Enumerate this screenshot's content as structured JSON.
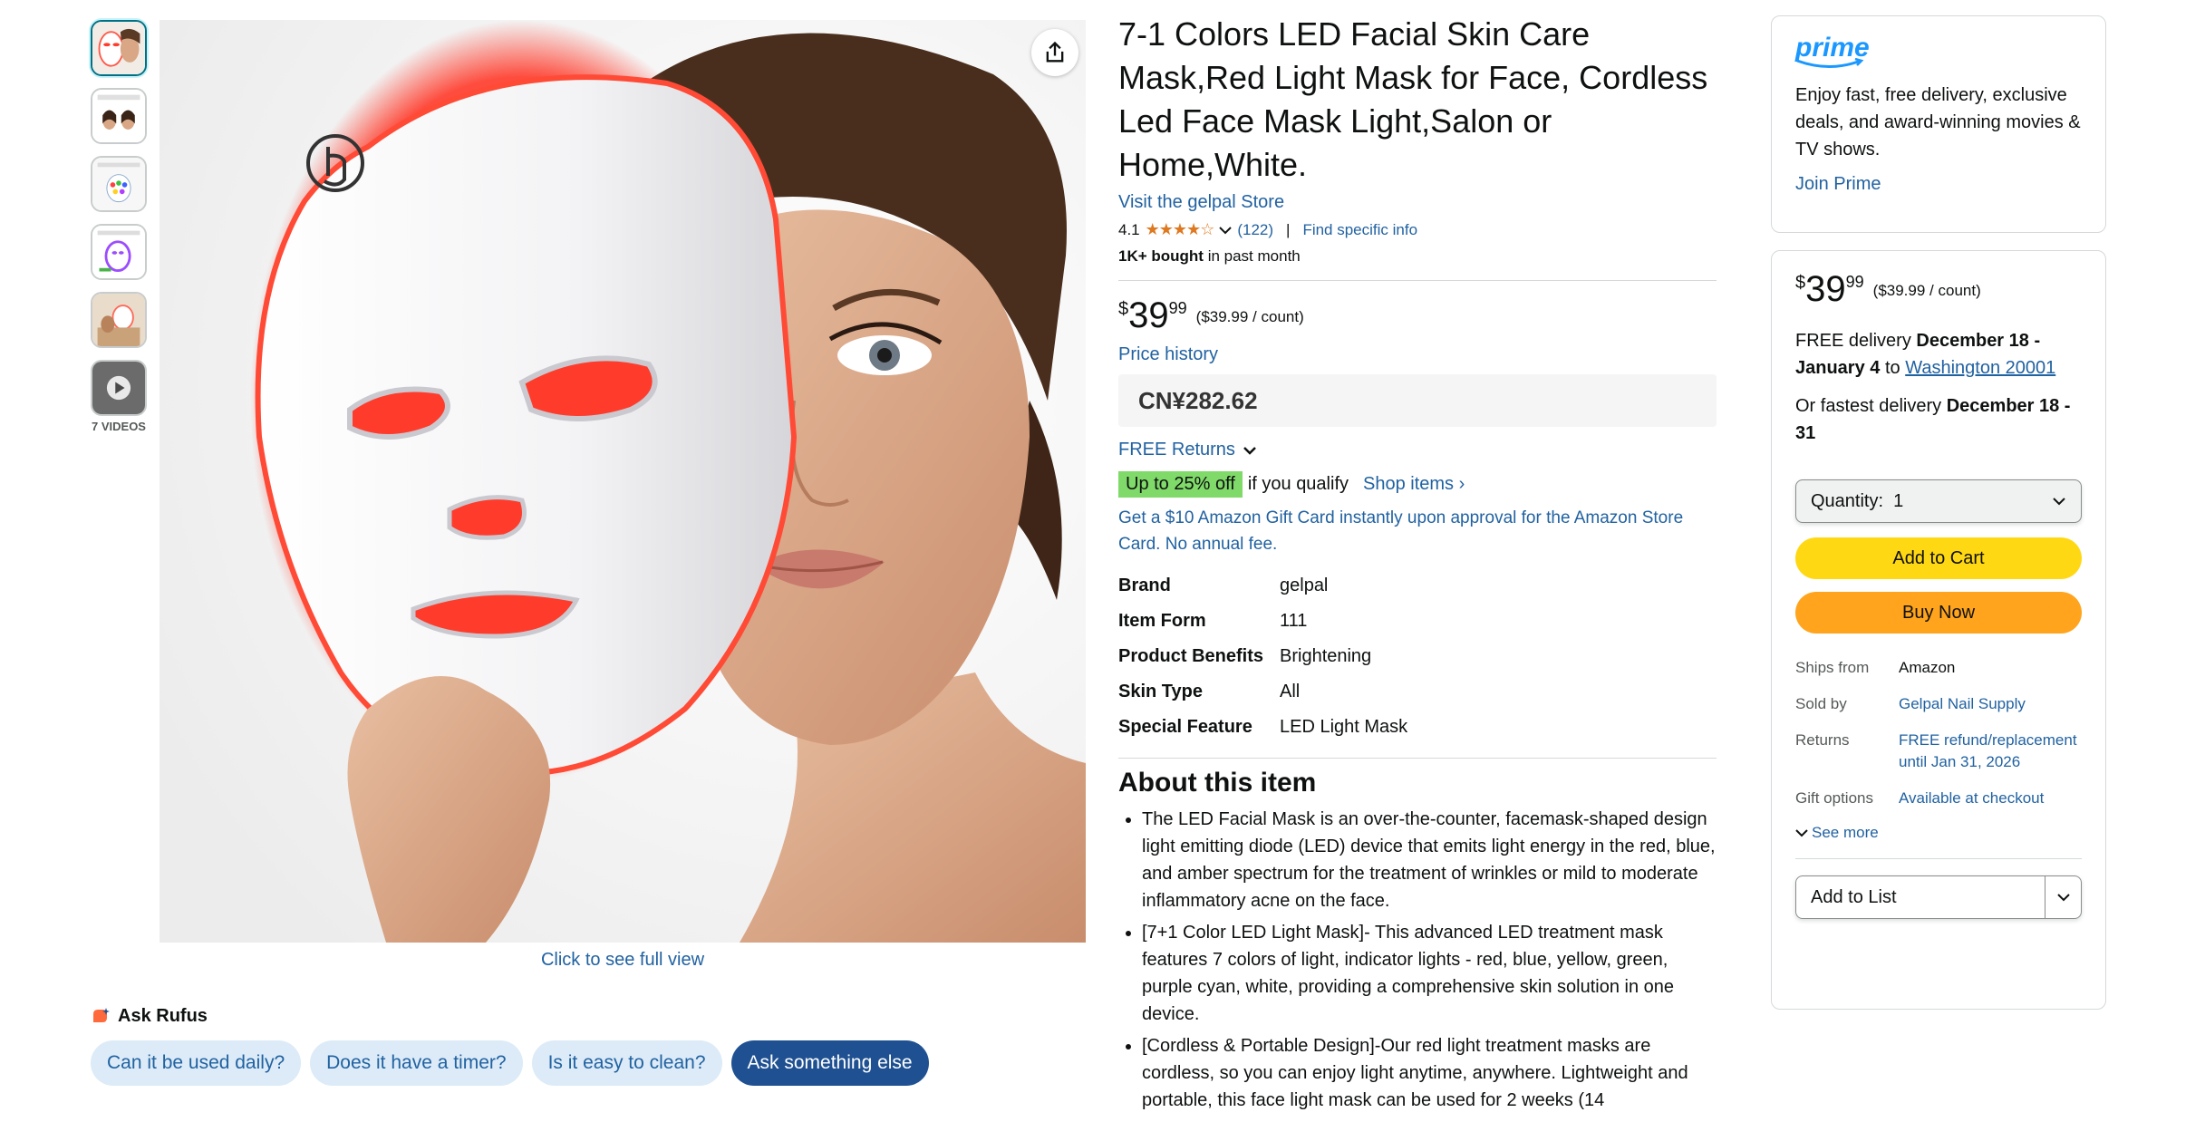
{
  "product": {
    "title": "7-1 Colors LED Facial Skin Care Mask,Red Light Mask for Face, Cordless Led Face Mask Light,Salon or Home,White.",
    "store_link": "Visit the gelpal Store",
    "rating": "4.1",
    "stars": "★★★★☆",
    "review_count": "(122)",
    "find_info": "Find specific info",
    "bought_bold": "1K+ bought",
    "bought_rest": " in past month"
  },
  "gallery": {
    "videos_label": "7 VIDEOS",
    "full_view": "Click to see full view"
  },
  "rufus": {
    "title": "Ask Rufus",
    "chips": [
      "Can it be used daily?",
      "Does it have a timer?",
      "Is it easy to clean?",
      "Ask something else"
    ]
  },
  "price": {
    "symbol": "$",
    "whole": "39",
    "fraction": "99",
    "unit": "($39.99 / count)",
    "history": "Price history",
    "cny": "CN¥282.62"
  },
  "returns": {
    "label": "FREE Returns"
  },
  "promo": {
    "badge": "Up to 25% off",
    "text": "if you qualify",
    "shop_items": "Shop items ›",
    "gift_card": "Get a $10 Amazon Gift Card instantly upon approval for the Amazon Store Card. No annual fee."
  },
  "specs": [
    {
      "key": "Brand",
      "value": "gelpal"
    },
    {
      "key": "Item Form",
      "value": "111"
    },
    {
      "key": "Product Benefits",
      "value": "Brightening"
    },
    {
      "key": "Skin Type",
      "value": "All"
    },
    {
      "key": "Special Feature",
      "value": "LED Light Mask"
    }
  ],
  "about": {
    "title": "About this item",
    "bullets": [
      "The LED Facial Mask is an over-the-counter, facemask-shaped design light emitting diode (LED) device that emits light energy in the red, blue, and amber spectrum for the treatment of wrinkles or mild to moderate inflammatory acne on the face.",
      "[7+1 Color LED Light Mask]- This advanced LED treatment mask features 7 colors of light, indicator lights - red, blue, yellow, green, purple cyan, white, providing a comprehensive skin solution in one device.",
      "[Cordless & Portable Design]-Our red light treatment masks are cordless, so you can enjoy light anytime, anywhere. Lightweight and portable, this face light mask can be used for 2 weeks (14"
    ]
  },
  "prime": {
    "logo": "prime",
    "text": "Enjoy fast, free delivery, exclusive deals, and award-winning movies & TV shows.",
    "join": "Join Prime"
  },
  "buybox": {
    "delivery_prefix": "FREE delivery ",
    "delivery_dates": "December 18 - January 4",
    "delivery_to": " to ",
    "delivery_location": "Washington 20001",
    "fastest_prefix": "Or fastest delivery ",
    "fastest_dates": "December 18 - 31",
    "quantity_label": "Quantity:",
    "quantity_value": "1",
    "add_to_cart": "Add to Cart",
    "buy_now": "Buy Now",
    "ships_from_key": "Ships from",
    "ships_from_val": "Amazon",
    "sold_by_key": "Sold by",
    "sold_by_val": "Gelpal Nail Supply",
    "returns_key": "Returns",
    "returns_val": "FREE refund/replacement until Jan 31, 2026",
    "gift_key": "Gift options",
    "gift_val": "Available at checkout",
    "see_more": "See more",
    "add_to_list": "Add to List"
  },
  "colors": {
    "link": "#2162a1",
    "cart": "#ffd814",
    "buy": "#ffa41c",
    "promo": "#7fda69",
    "prime": "#1a98ff",
    "star": "#de7921"
  }
}
